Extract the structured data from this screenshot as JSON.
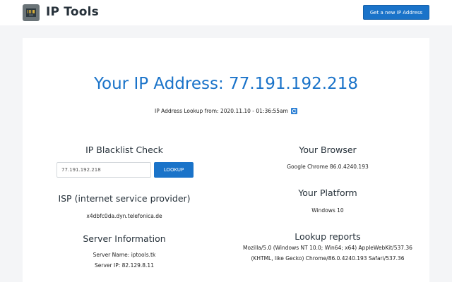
{
  "header": {
    "brand": "IP Tools",
    "logo_icon": "ethernet-port-icon",
    "new_ip_button": "Get a new IP Address"
  },
  "main": {
    "headline": "Your IP Address: 77.191.192.218",
    "lookup_text": "IP Address Lookup from: 2020.11.10 - 01:36:55am",
    "refresh_icon": "refresh-icon"
  },
  "blacklist": {
    "title": "IP Blacklist Check",
    "input_value": "77.191.192.218",
    "button_label": "LOOKUP"
  },
  "isp": {
    "title": "ISP (internet service provider)",
    "value": "x4dbfc0da.dyn.telefonica.de"
  },
  "server": {
    "title": "Server Information",
    "name_line": "Server Name: iptools.tk",
    "ip_line": "Server IP: 82.129.8.11"
  },
  "browser": {
    "title": "Your Browser",
    "value": "Google Chrome 86.0.4240.193"
  },
  "platform": {
    "title": "Your Platform",
    "value": "Windows 10"
  },
  "reports": {
    "title": "Lookup reports",
    "line1": "Mozilla/5.0 (Windows NT 10.0; Win64; x64) AppleWebKit/537.36",
    "line2": "(KHTML, like Gecko) Chrome/86.0.4240.193 Safari/537.36"
  },
  "colors": {
    "accent": "#1a73c9",
    "heading": "#26313a",
    "background": "#f4f5f7"
  }
}
